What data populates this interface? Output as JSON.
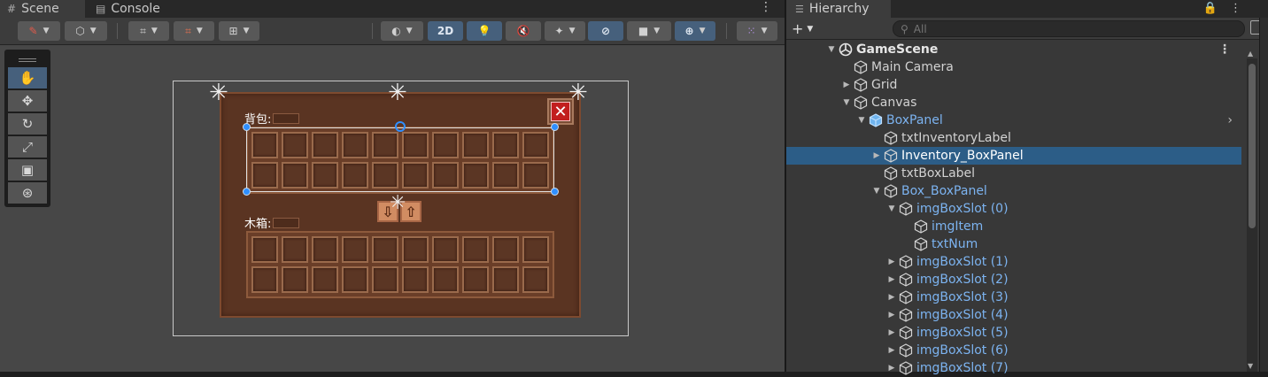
{
  "scene": {
    "tabs": [
      {
        "label": "Scene",
        "icon": "grid-icon"
      },
      {
        "label": "Console",
        "icon": "console-icon"
      }
    ],
    "toolbar": {
      "btn_2d": "2D"
    },
    "panel": {
      "backpack_label": "背包:",
      "chest_label": "木箱:"
    }
  },
  "hierarchy": {
    "tab_label": "Hierarchy",
    "search_placeholder": "All",
    "add_label": "+",
    "items": [
      {
        "label": "GameScene"
      },
      {
        "label": "Main Camera"
      },
      {
        "label": "Grid"
      },
      {
        "label": "Canvas"
      },
      {
        "label": "BoxPanel"
      },
      {
        "label": "txtInventoryLabel"
      },
      {
        "label": "Inventory_BoxPanel"
      },
      {
        "label": "txtBoxLabel"
      },
      {
        "label": "Box_BoxPanel"
      },
      {
        "label": "imgBoxSlot (0)"
      },
      {
        "label": "imgItem"
      },
      {
        "label": "txtNum"
      },
      {
        "label": "imgBoxSlot (1)"
      },
      {
        "label": "imgBoxSlot (2)"
      },
      {
        "label": "imgBoxSlot (3)"
      },
      {
        "label": "imgBoxSlot (4)"
      },
      {
        "label": "imgBoxSlot (5)"
      },
      {
        "label": "imgBoxSlot (6)"
      },
      {
        "label": "imgBoxSlot (7)"
      }
    ]
  },
  "colors": {
    "selection": "#2c5d87",
    "prefab_blue": "#7cb3f0",
    "panel_brown": "#5a3422",
    "accent_blue": "#46607c"
  }
}
